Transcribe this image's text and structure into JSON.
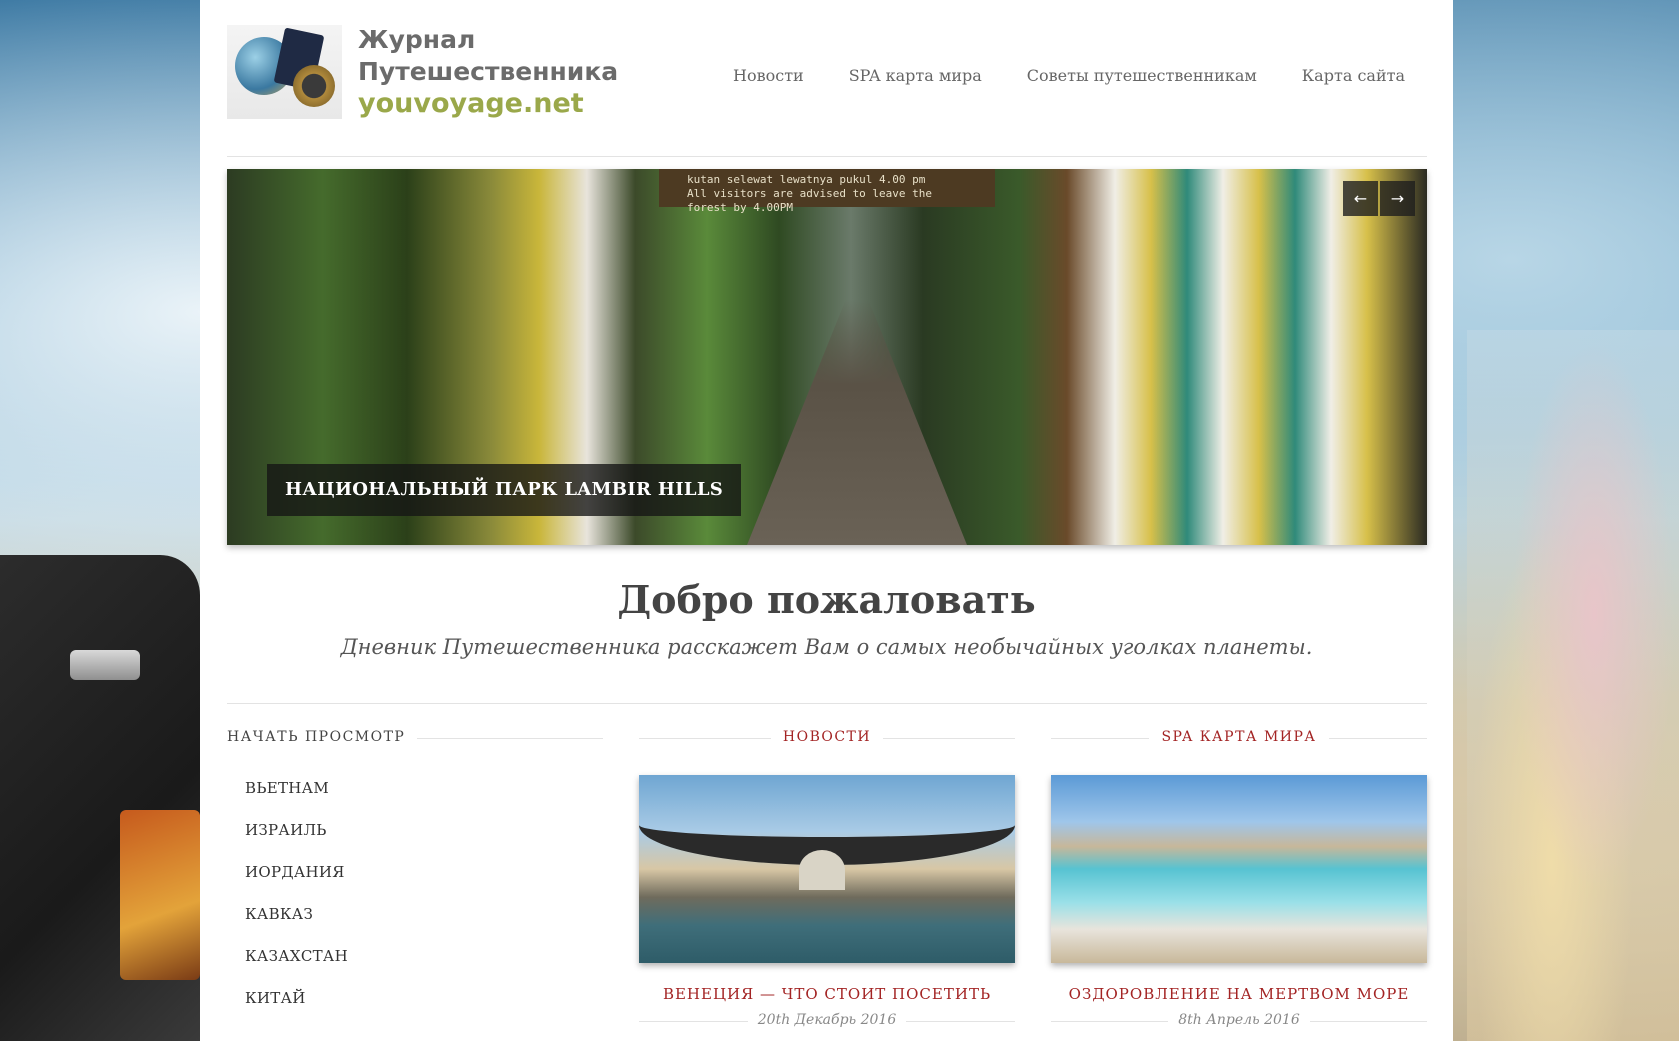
{
  "site": {
    "logo_line1": "Журнал",
    "logo_line2": "Путешественника",
    "logo_line3": "youvoyage.net"
  },
  "nav": {
    "items": [
      "Новости",
      "SPA карта мира",
      "Советы путешественникам",
      "Карта сайта"
    ]
  },
  "slider": {
    "caption": "НАЦИОНАЛЬНЫЙ ПАРК LAMBIR HILLS",
    "sign_text_1": "kutan selewat lewatnya pukul 4.00 pm",
    "sign_text_2": "All visitors are advised to leave the",
    "sign_text_3": "forest by 4.00PM",
    "prev_label": "←",
    "next_label": "→"
  },
  "welcome": {
    "title": "Добро пожаловать",
    "subtitle": "Дневник Путешественника расскажет Вам о самых необычайных уголках планеты."
  },
  "browse": {
    "heading": "НАЧАТЬ ПРОСМОТР",
    "categories": [
      "ВЬЕТНАМ",
      "ИЗРАИЛЬ",
      "ИОРДАНИЯ",
      "КАВКАЗ",
      "КАЗАХСТАН",
      "КИТАЙ"
    ]
  },
  "news": {
    "heading": "НОВОСТИ",
    "post_title": "ВЕНЕЦИЯ — ЧТО СТОИТ ПОСЕТИТЬ",
    "post_date": "20th Декабрь 2016"
  },
  "spa": {
    "heading": "SPA КАРТА МИРА",
    "post_title": "ОЗДОРОВЛЕНИЕ НА МЕРТВОМ МОРЕ",
    "post_date": "8th Апрель 2016"
  },
  "colors": {
    "accent": "#a32424",
    "logo_green": "#9aa84a",
    "text": "#444444"
  }
}
